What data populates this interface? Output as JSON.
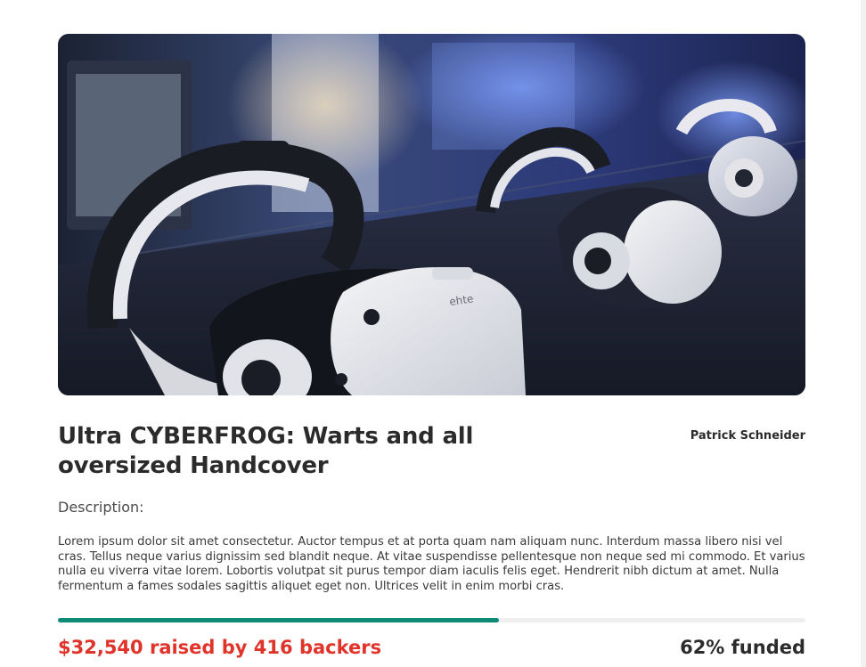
{
  "campaign": {
    "title": "Ultra CYBERFROG: Warts and all oversized Handcover",
    "creator": "Patrick Schneider",
    "description_label": "Description:",
    "description": "Lorem ipsum dolor sit amet consectetur. Auctor tempus et at porta quam nam aliquam nunc. Interdum massa libero nisi vel cras. Tellus neque varius dignissim sed blandit neque. At vitae suspendisse pellentesque non neque sed mi commodo. Et varius nulla eu viverra vitae lorem. Lobortis volutpat sit purus tempor diam iaculis felis eget. Hendrerit nibh dictum at amet. Nulla fermentum a fames sodales sagittis aliquet eget non. Ultrices velit in enim morbi cras.",
    "raised_text": "$32,540 raised by 416 backers",
    "funded_text": "62% funded",
    "progress_fraction": 0.59,
    "headset_brand_text": "ehte"
  },
  "colors": {
    "accent": "#0e8a76",
    "raised": "#e0342b",
    "track": "#efefef"
  }
}
